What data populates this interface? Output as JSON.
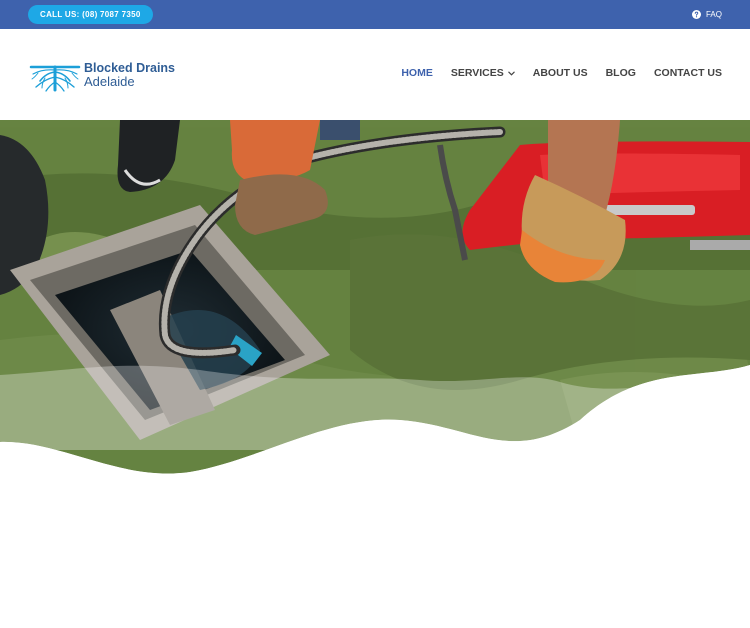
{
  "topbar": {
    "call_label": "CALL US: (08) 7087 7350",
    "faq_label": "FAQ",
    "faq_icon": "question-circle-icon",
    "background": "#3e62ad",
    "button_color": "#1ea8e6"
  },
  "logo": {
    "line1": "Blocked Drains",
    "line2": "Adelaide",
    "icon": "drain-roots-icon",
    "color": "#2f5d95"
  },
  "nav": {
    "items": [
      {
        "label": "HOME",
        "active": true
      },
      {
        "label": "SERVICES",
        "has_dropdown": true
      },
      {
        "label": "ABOUT US"
      },
      {
        "label": "BLOG"
      },
      {
        "label": "CONTACT US"
      }
    ],
    "active_color": "#3e62ad",
    "text_color": "#444444"
  },
  "hero": {
    "image": "drain-cleaning-photo",
    "description_icon": "wave-divider"
  }
}
